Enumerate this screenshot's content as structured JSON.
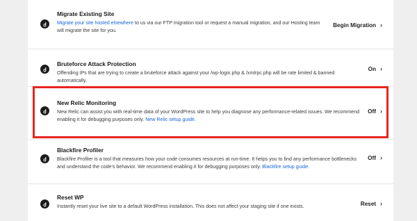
{
  "rows": [
    {
      "title": "Migrate Existing Site",
      "desc_link_prefix": "Migrate your site hosted elsewhere",
      "desc_text": " to us via our FTP migration tool or request a manual migration, and our Hosting team will migrate the site for you.",
      "action": "Begin Migration",
      "icon": "logo-icon"
    },
    {
      "title": "Bruteforce Attack Protection",
      "desc_text": "Offending IPs that are trying to create a bruteforce attack against your /wp-login.php & /xmlrpc.php will be rate limited & banned automatically.",
      "action": "On",
      "icon": "logo-icon"
    },
    {
      "title": "New Relic Monitoring",
      "desc_text": "New Relic can assist you with real-time data of your WordPress site to help you diagnose any performance-related issues. We recommend enabling it for debugging purposes only. ",
      "desc_link_suffix": "New Relic setup guide.",
      "action": "Off",
      "icon": "logo-icon"
    },
    {
      "title": "Blackfire Profiler",
      "desc_text": "Blackfire Profiler is a tool that measures how your code consumes resources at run-time. It helps you to find any performance bottlenecks and understand the code's behavior. We recommend enabling it for debugging purposes only. ",
      "desc_link_suffix": "Blackfire setup guide.",
      "action": "Off",
      "icon": "logo-icon"
    },
    {
      "title": "Reset WP",
      "desc_text": "Instantly reset your live site to a default WordPress installation. This does not affect your staging site if one exists.",
      "action": "Reset",
      "icon": "logo-icon"
    }
  ],
  "chevron": "›",
  "highlight_color": "#e8251f"
}
